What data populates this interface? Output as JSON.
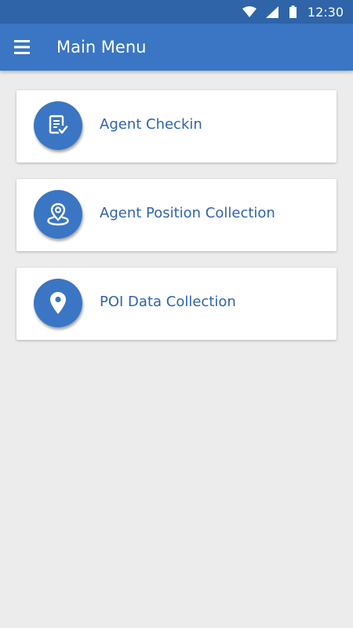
{
  "status_bar": {
    "time": "12:30",
    "icons": [
      "wifi-icon",
      "signal-icon",
      "battery-icon"
    ]
  },
  "app_bar": {
    "title": "Main Menu",
    "menu_icon": "hamburger-menu-icon"
  },
  "menu": {
    "items": [
      {
        "label": "Agent Checkin",
        "icon": "checklist-document-icon"
      },
      {
        "label": "Agent Position Collection",
        "icon": "map-pin-on-ground-icon"
      },
      {
        "label": "POI Data Collection",
        "icon": "map-pin-icon"
      }
    ]
  },
  "colors": {
    "status_bar": "#2f64a8",
    "app_bar": "#3a76c4",
    "background": "#ececec",
    "card": "#ffffff",
    "accent": "#3a76c4",
    "label_text": "#2f63ad"
  }
}
